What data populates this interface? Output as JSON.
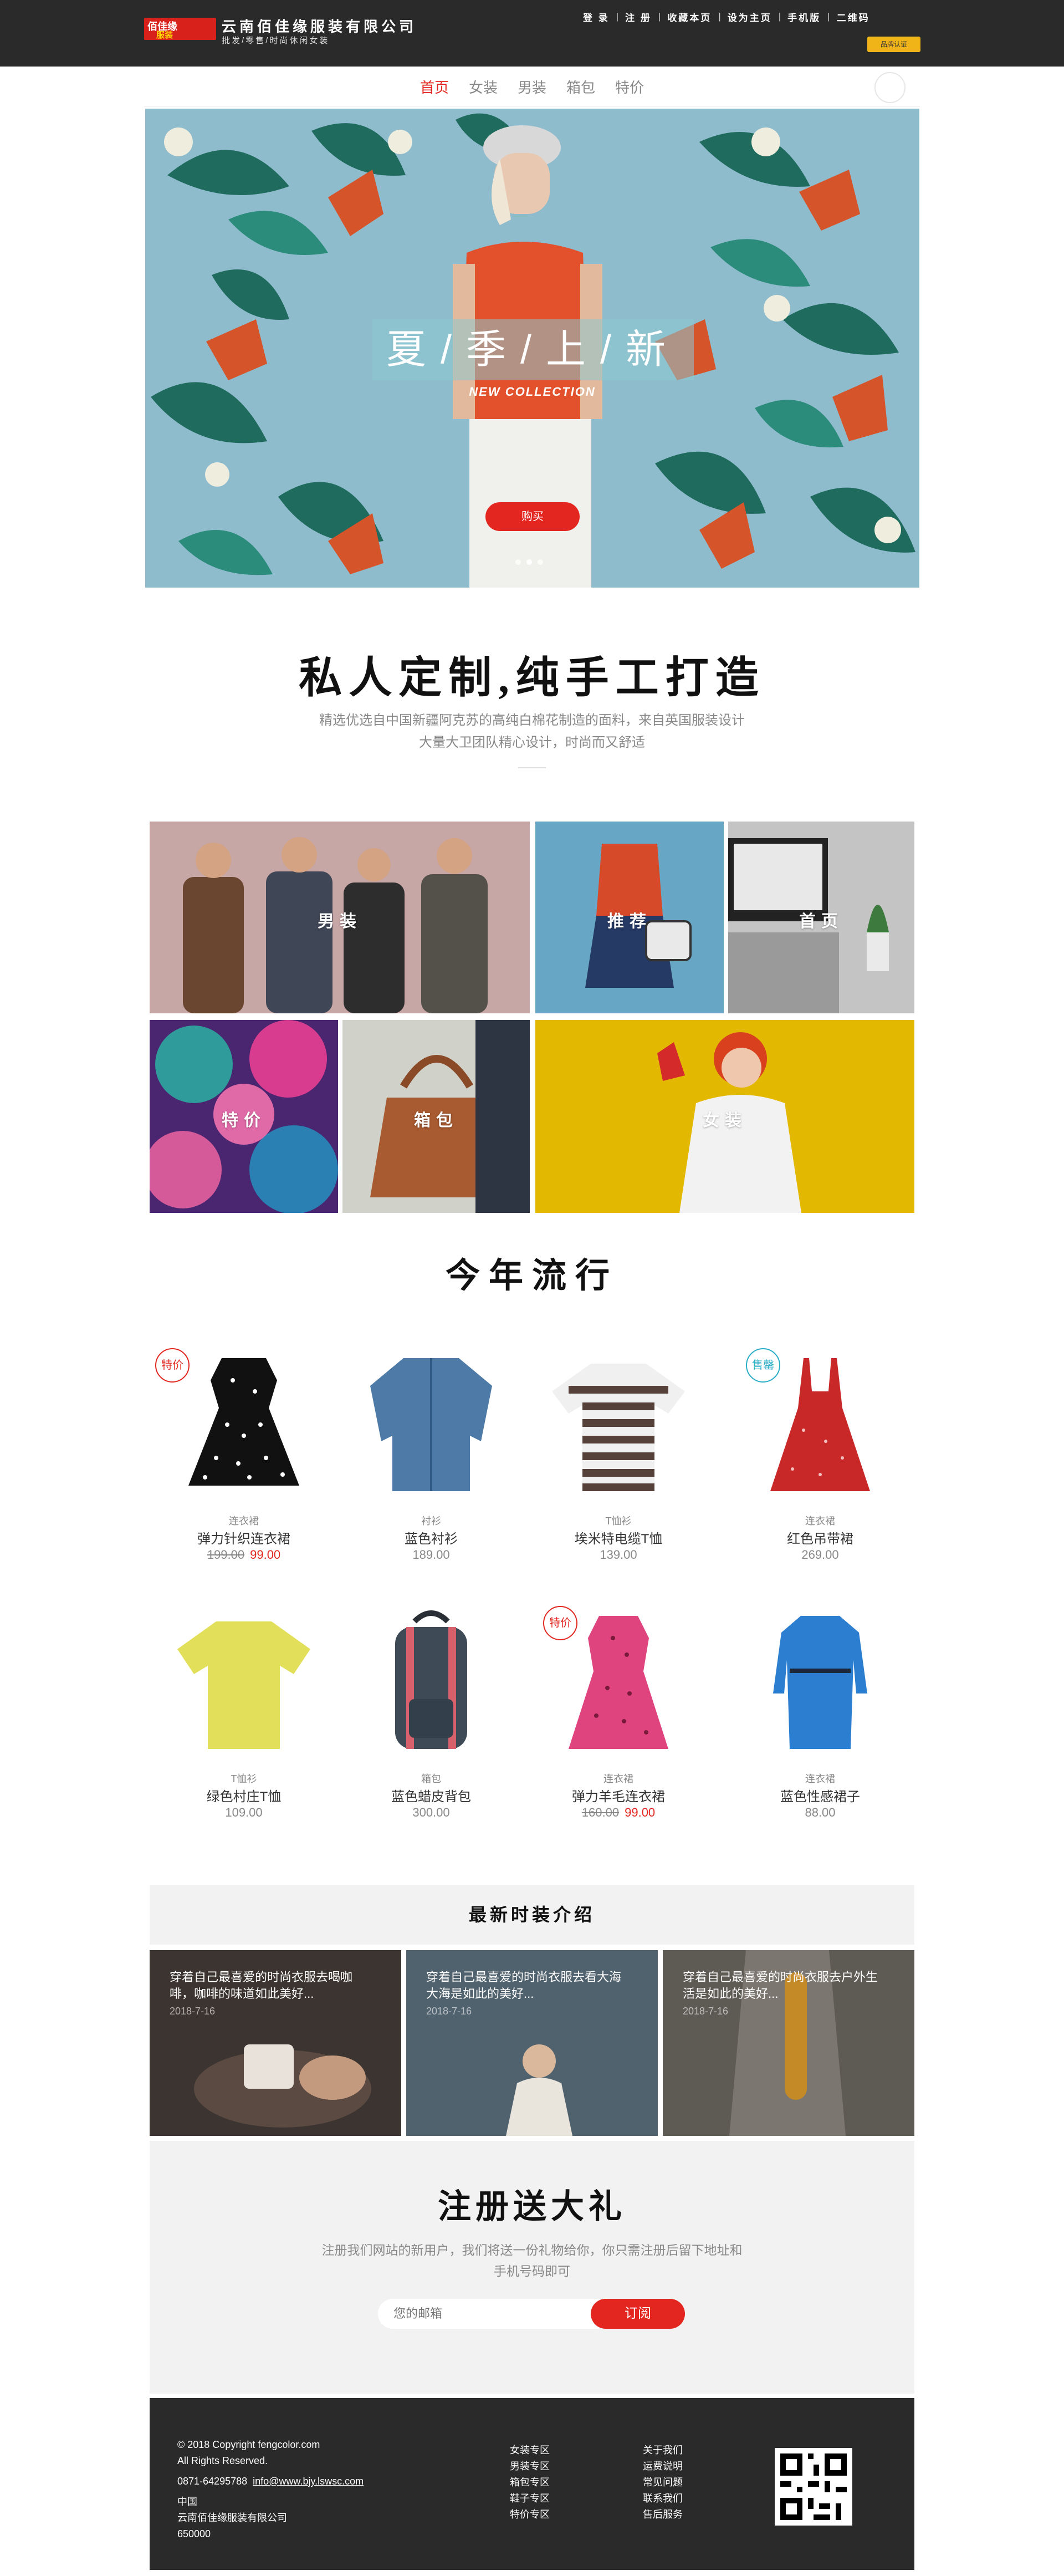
{
  "header": {
    "logo_line1": "佰佳缘",
    "logo_line2": "服装",
    "company_name": "云南佰佳缘服装有限公司",
    "company_sub": "批发/零售/时尚休闲女装",
    "links": [
      "登 录",
      "注 册",
      "收藏本页",
      "设为主页",
      "手机版",
      "二维码"
    ],
    "badge_text": "品牌认证"
  },
  "nav": {
    "items": [
      "首页",
      "女装",
      "男装",
      "箱包",
      "特价"
    ],
    "active_index": 0
  },
  "hero": {
    "title": "夏/季/上/新",
    "subtitle": "NEW COLLECTION",
    "button": "购买",
    "slide_count": 3,
    "active_slide": 1
  },
  "intro": {
    "title": "私人定制,纯手工打造",
    "text": "精选优选自中国新疆阿克苏的高纯白棉花制造的面料，来自英国服装设计大量大卫团队精心设计，时尚而又舒适"
  },
  "categories": [
    "男装",
    "推荐",
    "首页",
    "特价",
    "箱包",
    "女装"
  ],
  "trending": {
    "title": "今年流行",
    "products": [
      {
        "category": "连衣裙",
        "name": "弹力针织连衣裙",
        "old_price": "199.00",
        "price": "99.00",
        "tag": "特价"
      },
      {
        "category": "衬衫",
        "name": "蓝色衬衫",
        "old_price": "",
        "price": "189.00",
        "tag": ""
      },
      {
        "category": "T恤衫",
        "name": "埃米特电缆T恤",
        "old_price": "",
        "price": "139.00",
        "tag": ""
      },
      {
        "category": "连衣裙",
        "name": "红色吊带裙",
        "old_price": "",
        "price": "269.00",
        "tag": "售罄"
      },
      {
        "category": "T恤衫",
        "name": "绿色村庄T恤",
        "old_price": "",
        "price": "109.00",
        "tag": ""
      },
      {
        "category": "箱包",
        "name": "蓝色蜡皮背包",
        "old_price": "",
        "price": "300.00",
        "tag": ""
      },
      {
        "category": "连衣裙",
        "name": "弹力羊毛连衣裙",
        "old_price": "160.00",
        "price": "99.00",
        "tag": "特价"
      },
      {
        "category": "连衣裙",
        "name": "蓝色性感裙子",
        "old_price": "",
        "price": "88.00",
        "tag": ""
      }
    ]
  },
  "news": {
    "title": "最新时装介绍",
    "cards": [
      {
        "text": "穿着自己最喜爱的时尚衣服去喝咖啡，咖啡的味道如此美好...",
        "date": "2018-7-16"
      },
      {
        "text": "穿着自己最喜爱的时尚衣服去看大海大海是如此的美好...",
        "date": "2018-7-16"
      },
      {
        "text": "穿着自己最喜爱的时尚衣服去户外生活是如此的美好...",
        "date": "2018-7-16"
      }
    ]
  },
  "register": {
    "title": "注册送大礼",
    "text": "注册我们网站的新用户，我们将送一份礼物给你，你只需注册后留下地址和手机号码即可",
    "placeholder": "您的邮箱",
    "button": "订阅"
  },
  "footer": {
    "copyright": "© 2018 Copyright fengcolor.com",
    "rights": "All Rights Reserved.",
    "phone": "0871-64295788",
    "site": "info@www.bjy.lswsc.com",
    "country": "中国",
    "company": "云南佰佳缘服装有限公司",
    "postcode": "650000",
    "col2": [
      "女装专区",
      "男装专区",
      "箱包专区",
      "鞋子专区",
      "特价专区"
    ],
    "col3": [
      "关于我们",
      "运费说明",
      "常见问题",
      "联系我们",
      "售后服务"
    ]
  },
  "colors": {
    "accent": "#e3261f",
    "dark": "#2a2a2a",
    "light_bg": "#f2f2f2"
  }
}
